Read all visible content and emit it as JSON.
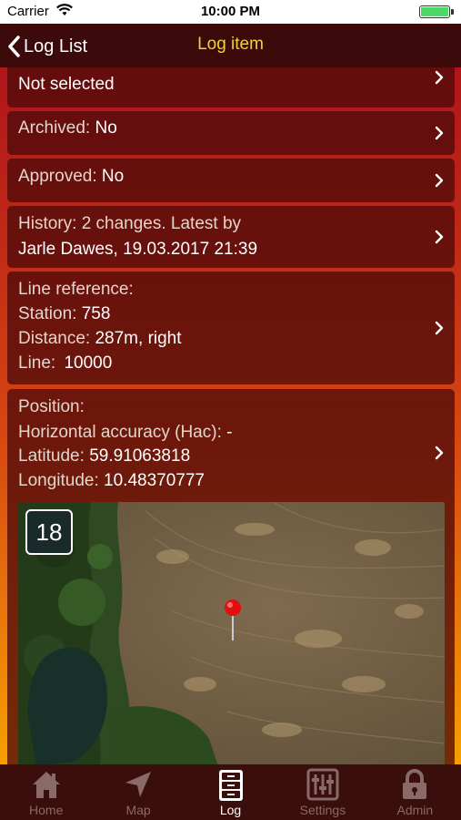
{
  "status_bar": {
    "carrier": "Carrier",
    "time": "10:00 PM"
  },
  "nav": {
    "back_label": "Log List",
    "title": "Log item",
    "title_color": "#f0d03a"
  },
  "cells": {
    "procedure": {
      "value": "Not selected"
    },
    "archived": {
      "label": "Archived:",
      "value": "No"
    },
    "approved": {
      "label": "Approved:",
      "value": "No"
    },
    "history": {
      "label": "History:",
      "value": "2 changes. Latest by",
      "detail": "Jarle Dawes, 19.03.2017 21:39"
    },
    "line_reference": {
      "heading": "Line reference:",
      "station_label": "Station:",
      "station_value": "758",
      "distance_label": "Distance:",
      "distance_value": "287m, right",
      "line_label": "Line:",
      "line_value": "10000"
    },
    "position": {
      "heading": "Position:",
      "hac_label": "Horizontal accuracy (Hac):",
      "hac_value": "-",
      "latitude_label": "Latitude:",
      "latitude_value": "59.91063818",
      "longitude_label": "Longitude:",
      "longitude_value": "10.48370777",
      "zoom": "18"
    }
  },
  "tabs": [
    {
      "label": "Home",
      "icon": "home-icon",
      "active": false
    },
    {
      "label": "Map",
      "icon": "navigation-arrow-icon",
      "active": false
    },
    {
      "label": "Log",
      "icon": "file-cabinet-icon",
      "active": true
    },
    {
      "label": "Settings",
      "icon": "sliders-icon",
      "active": false
    },
    {
      "label": "Admin",
      "icon": "lock-icon",
      "active": false
    }
  ]
}
